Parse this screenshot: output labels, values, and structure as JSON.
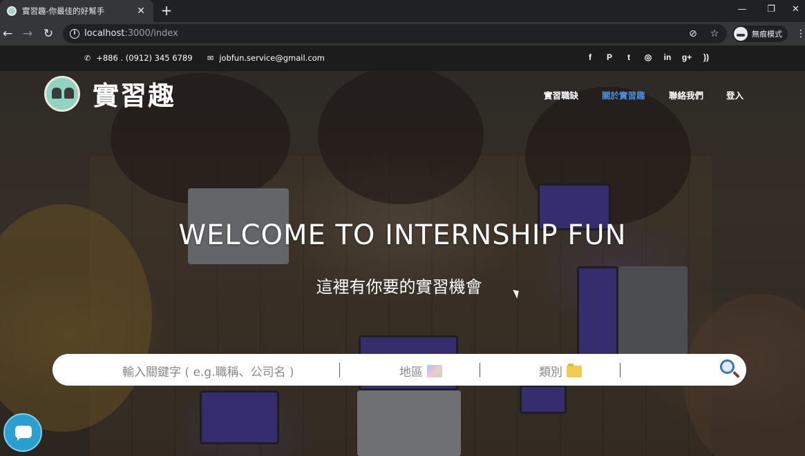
{
  "browser": {
    "tab_title": "實習趣-你最佳的好幫手",
    "tab_close": "✕",
    "new_tab": "+",
    "url_host": "localhost",
    "url_path": ":3000/index",
    "incognito_label": "無痕模式",
    "window_controls": {
      "minimize": "—",
      "restore": "❐",
      "close": "✕"
    }
  },
  "topbar": {
    "phone": "+886 . (0912) 345 6789",
    "email": "jobfun.service@gmail.com",
    "social_icons": [
      "facebook-icon",
      "pinterest-icon",
      "twitter-icon",
      "dribbble-icon",
      "linkedin-icon",
      "google-plus-icon",
      "rss-icon"
    ],
    "social_glyphs": {
      "facebook": "f",
      "pinterest": "P",
      "twitter": "t",
      "dribbble": "◎",
      "linkedin": "in",
      "google_plus": "g+",
      "rss": "))"
    }
  },
  "logo_text": "實習趣",
  "nav": {
    "items": [
      {
        "label": "實習職缺",
        "color": "#ffffff"
      },
      {
        "label": "關於實習趣",
        "color": "#4a90e2"
      },
      {
        "label": "聯絡我們",
        "color": "#ffffff"
      },
      {
        "label": "登入",
        "color": "#ffffff"
      }
    ]
  },
  "hero": {
    "title": "WELCOME TO INTERNSHIP FUN",
    "subtitle": "這裡有你要的實習機會"
  },
  "search": {
    "keyword_placeholder": "輸入關鍵字 ( e.g.職稱、公司名 )",
    "region_label": "地區",
    "category_label": "類別",
    "region_icon": "map-icon",
    "category_icon": "folder-icon",
    "submit_icon": "magnifier-icon"
  },
  "chat_icon": "chat-icon"
}
